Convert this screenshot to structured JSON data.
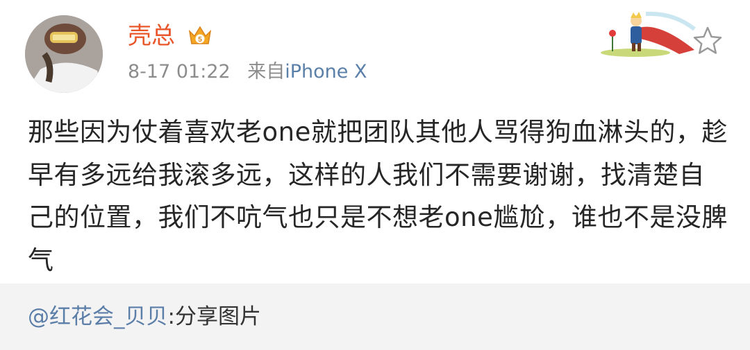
{
  "post": {
    "username": "壳总",
    "vip_level": "5",
    "timestamp": "8-17 01:22",
    "source_prefix": "来自",
    "source_device": "iPhone X",
    "text": "那些因为仗着喜欢老one就把团队其他人骂得狗血淋头的，趁早有多远给我滚多远，这样的人我们不需要谢谢，找清楚自己的位置，我们不吭气也只是不想老one尴尬，谁也不是没脾气"
  },
  "share": {
    "mention": "@红花会_贝贝",
    "description": ":分享图片"
  },
  "icons": {
    "favorite": "star-outline-icon",
    "badge": "crown-icon"
  },
  "colors": {
    "username": "#e8562a",
    "link": "#5b7ea8",
    "meta": "#8c8c8c",
    "share_bg": "#f3f3f3"
  }
}
